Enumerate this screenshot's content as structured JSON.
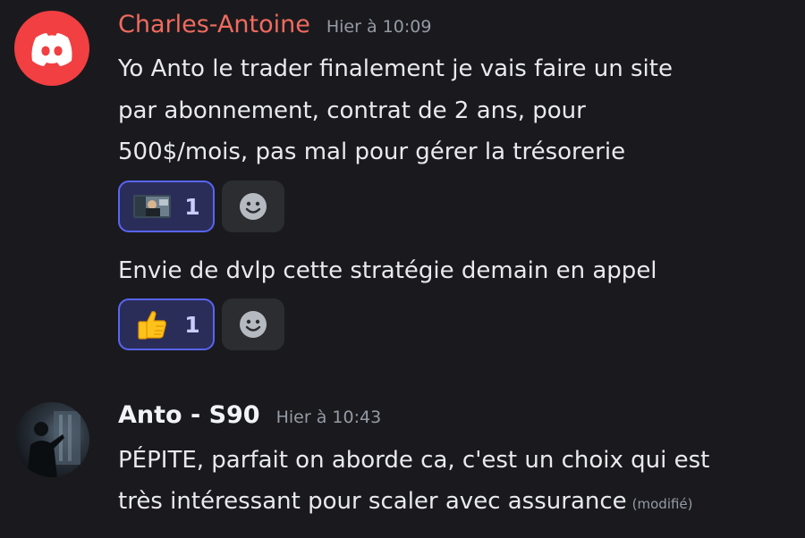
{
  "messages": [
    {
      "author": "Charles-Antoine",
      "author_color": "#f06a5e",
      "avatar": "discord-logo-icon",
      "timestamp": "Hier à 10:09",
      "blocks": [
        {
          "lines": [
            "Yo Anto le trader finalement je vais faire un site",
            "par abonnement, contrat de 2 ans, pour",
            "500$/mois, pas mal pour gérer la trésorerie"
          ],
          "reaction": {
            "emoji": "gif-image-icon",
            "count": "1"
          }
        },
        {
          "lines": [
            "Envie de dvlp cette stratégie demain en appel"
          ],
          "reaction": {
            "emoji": "thumbs-up-icon",
            "count": "1"
          }
        }
      ]
    },
    {
      "author": "Anto - S90",
      "author_color": "#f2f3f5",
      "avatar": "user-photo",
      "timestamp": "Hier à 10:43",
      "lines": [
        "PÉPITE, parfait on aborde ca, c'est un choix qui est",
        "très intéressant pour scaler avec assurance"
      ],
      "edited_label": "(modifié)"
    }
  ],
  "colors": {
    "background": "#1a1a1e",
    "reaction_active_bg": "#2b2d59",
    "reaction_active_border": "#5865f2",
    "add_reaction_bg": "#2b2d31"
  }
}
